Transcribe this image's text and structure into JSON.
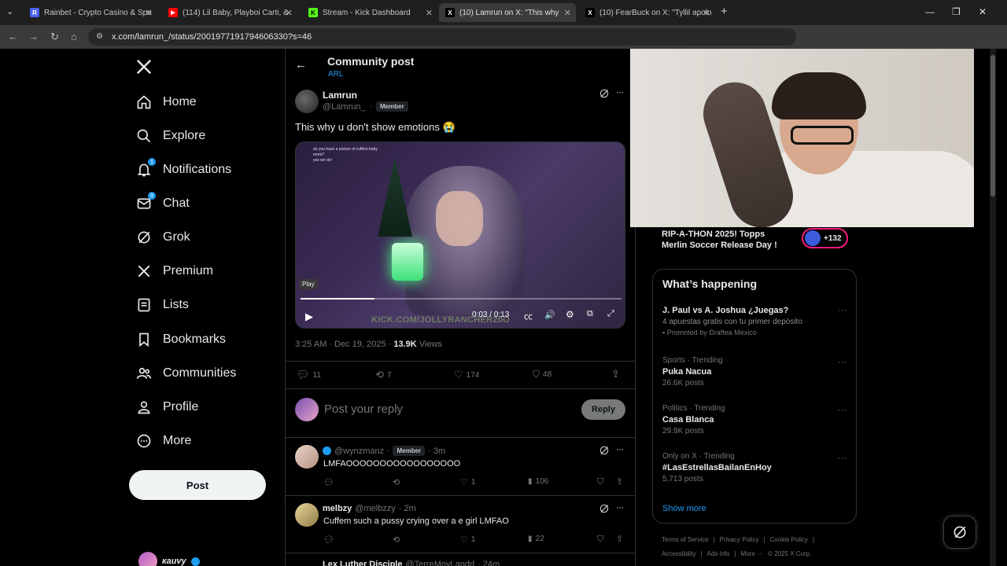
{
  "browser": {
    "tabs": [
      {
        "title": "Rainbet - Crypto Casino & Spo",
        "favicon": "R",
        "color": "#4a62f5"
      },
      {
        "title": "(114) Lil Baby, Playboi Carti, &",
        "favicon": "▶",
        "color": "#ff0000"
      },
      {
        "title": "Stream - Kick Dashboard",
        "favicon": "K",
        "color": "#53fc18"
      },
      {
        "title": "(10) Lamrun on X: \"This why",
        "favicon": "X",
        "color": "#000000"
      },
      {
        "title": "(10) FearBuck on X: \"Tyllil apolo",
        "favicon": "X",
        "color": "#000000"
      }
    ],
    "url": "x.com/lamrun_/status/2001977191794606330?s=46"
  },
  "sidebar": {
    "items": [
      {
        "label": "Home",
        "icon": "home-icon"
      },
      {
        "label": "Explore",
        "icon": "search-icon"
      },
      {
        "label": "Notifications",
        "icon": "bell-icon",
        "badge": "1"
      },
      {
        "label": "Chat",
        "icon": "mail-icon",
        "badge": "9"
      },
      {
        "label": "Grok",
        "icon": "grok-icon"
      },
      {
        "label": "Premium",
        "icon": "x-icon"
      },
      {
        "label": "Lists",
        "icon": "list-icon"
      },
      {
        "label": "Bookmarks",
        "icon": "bookmark-icon"
      },
      {
        "label": "Communities",
        "icon": "people-icon"
      },
      {
        "label": "Profile",
        "icon": "person-icon"
      },
      {
        "label": "More",
        "icon": "more-circle-icon"
      }
    ],
    "post_label": "Post",
    "account_name": "кaиvy"
  },
  "header": {
    "title": "Community post",
    "subtitle": "ARL"
  },
  "post": {
    "name": "Lamrun",
    "handle": "@Lamrun_",
    "member": "Member",
    "text": "This why u don't show emotions 😭",
    "video": {
      "play_tooltip": "Play",
      "time": "0:03 / 0:13",
      "watermark": "KICK.COM/JOLLYRANCHER20O",
      "progress": 0.23,
      "chat1": "do you have a picture of cuffem baby",
      "chat1b": "emre?",
      "chat2": "yes we do!"
    },
    "timestamp": "3:25 AM · Dec 19, 2025 · ",
    "views_count": "13.9K",
    "views_label": " Views",
    "replies": "11",
    "reposts": "7",
    "likes": "174",
    "bookmarks": "48"
  },
  "reply_box": {
    "placeholder": "Post your reply",
    "button": "Reply"
  },
  "replies": [
    {
      "name": "",
      "handle": "@wynzmanz",
      "member": "Member",
      "time": "· 3m",
      "text": "LMFAOOOOOOOOOOOOOOOOO",
      "likes": "1",
      "views": "106"
    },
    {
      "name": "melbzy",
      "handle": "@melbzzy",
      "time": "· 2m",
      "text": "Cuffem such a pussy crying over a e girl LMFAO",
      "likes": "1",
      "views": "22"
    },
    {
      "name": "Lex Luther Disciple",
      "handle": "@TerreMoyLandd",
      "time": "· 24m"
    }
  ],
  "promo": {
    "text": "RIP-A-THON 2025! Topps Merlin Soccer Release Day !",
    "count": "+132"
  },
  "happening": {
    "title": "What’s happening",
    "trends": [
      {
        "category": "",
        "name": "J. Paul vs A. Joshua ¿Juegas?",
        "desc": "4 apuestas gratis con tu primer depósito",
        "promoted": "Promoted by Draftea México"
      },
      {
        "category": "Sports · Trending",
        "name": "Puka Nacua",
        "count": "26.6K posts"
      },
      {
        "category": "Politics · Trending",
        "name": "Casa Blanca",
        "count": "29.9K posts"
      },
      {
        "category": "Only on X · Trending",
        "name": "#LasEstrellasBailanEnHoy",
        "count": "5,713 posts"
      }
    ],
    "show_more": "Show more"
  },
  "footer": {
    "links": [
      "Terms of Service",
      "|",
      "Privacy Policy",
      "|",
      "Cookie Policy",
      "|"
    ],
    "links2": [
      "Accessibility",
      "|",
      "Ads info",
      "|",
      "More ···",
      "© 2025 X Corp."
    ]
  }
}
